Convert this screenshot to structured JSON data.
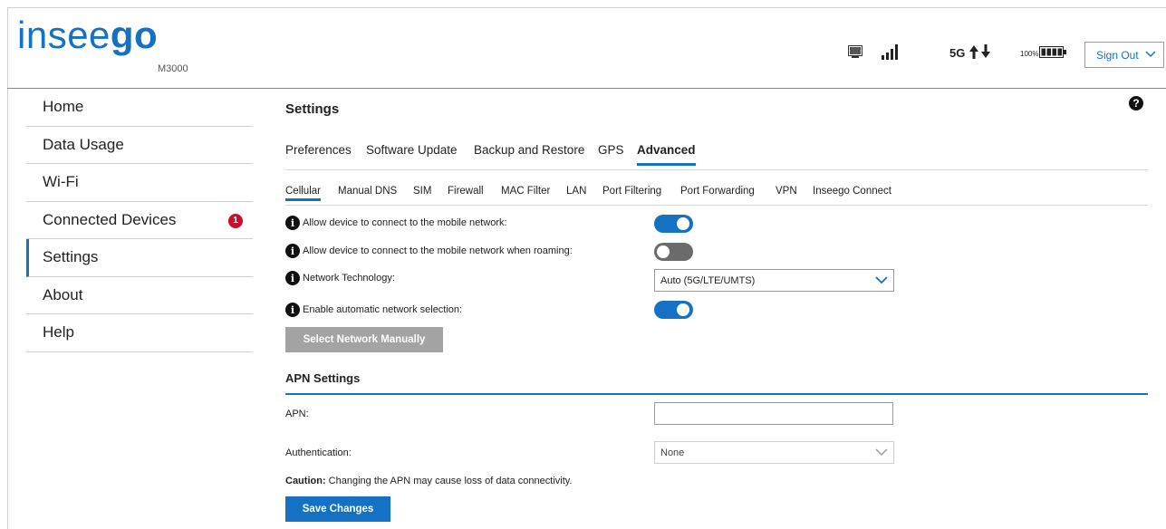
{
  "brand": {
    "logo_light": "insee",
    "logo_bold": "go",
    "model": "M3000",
    "color": "#1571c4"
  },
  "status": {
    "network": "5G",
    "battery_pct": "100%"
  },
  "header": {
    "sign_out_label": "Sign Out"
  },
  "sidebar": {
    "items": [
      {
        "label": "Home"
      },
      {
        "label": "Data Usage"
      },
      {
        "label": "Wi-Fi"
      },
      {
        "label": "Connected Devices",
        "badge": "1"
      },
      {
        "label": "Settings"
      },
      {
        "label": "About"
      },
      {
        "label": "Help"
      }
    ]
  },
  "main": {
    "title": "Settings",
    "help_glyph": "?",
    "tabs": [
      {
        "label": "Preferences"
      },
      {
        "label": "Software Update"
      },
      {
        "label": "Backup and Restore"
      },
      {
        "label": "GPS"
      },
      {
        "label": "Advanced"
      }
    ],
    "subtabs": [
      {
        "label": "Cellular"
      },
      {
        "label": "Manual DNS"
      },
      {
        "label": "SIM"
      },
      {
        "label": "Firewall"
      },
      {
        "label": "MAC Filter"
      },
      {
        "label": "LAN"
      },
      {
        "label": "Port Filtering"
      },
      {
        "label": "Port Forwarding"
      },
      {
        "label": "VPN"
      },
      {
        "label": "Inseego Connect"
      }
    ],
    "cellular": {
      "allow_mobile_label": "Allow device to connect to the mobile network:",
      "allow_mobile_on": true,
      "allow_roaming_label": "Allow device to connect to the mobile network when roaming:",
      "allow_roaming_on": false,
      "network_tech_label": "Network Technology:",
      "network_tech_value": "Auto (5G/LTE/UMTS)",
      "auto_select_label": "Enable automatic network selection:",
      "auto_select_on": true,
      "select_manual_label": "Select Network Manually"
    },
    "apn": {
      "section_title": "APN Settings",
      "apn_label": "APN:",
      "apn_value": "",
      "auth_label": "Authentication:",
      "auth_value": "None",
      "caution_bold": "Caution:",
      "caution_text": " Changing the APN may cause loss of data connectivity.",
      "save_label": "Save Changes"
    }
  }
}
